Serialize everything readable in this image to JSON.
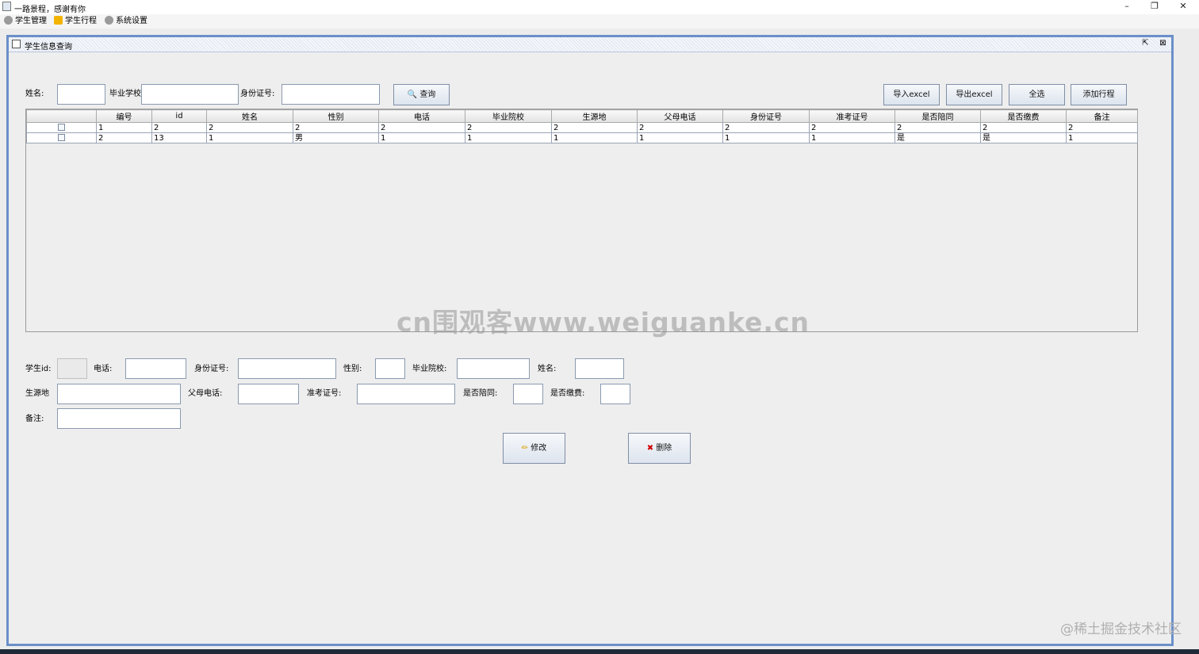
{
  "window": {
    "title": "一路景程，感谢有你",
    "minimize": "–",
    "restore": "❐",
    "close": "✕"
  },
  "menu": [
    {
      "label": "学生管理",
      "icon": "gear-icon",
      "color": "#9a9a9a"
    },
    {
      "label": "学生行程",
      "icon": "star-icon",
      "color": "#f2b400"
    },
    {
      "label": "系统设置",
      "icon": "gear-icon",
      "color": "#9a9a9a"
    }
  ],
  "frame": {
    "title": "学生信息查询",
    "float_icon": "⇱",
    "close_icon": "⊠"
  },
  "search": {
    "name_label": "姓名:",
    "name_value": "",
    "school_label": "毕业学校",
    "school_value": "",
    "idcard_label": "身份证号:",
    "idcard_value": "",
    "query_button": "查询"
  },
  "actions": {
    "import": "导入excel",
    "export": "导出excel",
    "select_all": "全选",
    "add_trip": "添加行程"
  },
  "table": {
    "columns": [
      "",
      "编号",
      "id",
      "姓名",
      "性别",
      "电话",
      "毕业院校",
      "生源地",
      "父母电话",
      "身份证号",
      "准考证号",
      "是否陪同",
      "是否缴费",
      "备注"
    ],
    "rows": [
      [
        "",
        "1",
        "2",
        "2",
        "2",
        "2",
        "2",
        "2",
        "2",
        "2",
        "2",
        "2",
        "2",
        "2"
      ],
      [
        "",
        "2",
        "13",
        "1",
        "男",
        "1",
        "1",
        "1",
        "1",
        "1",
        "1",
        "是",
        "是",
        "1"
      ]
    ]
  },
  "form": {
    "student_id_label": "学生id:",
    "student_id": "",
    "phone_label": "电话:",
    "phone": "",
    "idcard_label": "身份证号:",
    "idcard": "",
    "gender_label": "性别:",
    "gender": "",
    "school_label": "毕业院校:",
    "school": "",
    "name_label": "姓名:",
    "name": "",
    "origin_label": "生源地",
    "origin": "",
    "parent_phone_label": "父母电话:",
    "parent_phone": "",
    "exam_no_label": "准考证号:",
    "exam_no": "",
    "accompany_label": "是否陪同:",
    "accompany": "",
    "paid_label": "是否缴费:",
    "paid": "",
    "remark_label": "备注:",
    "remark": "",
    "edit_button": "修改",
    "delete_button": "删除"
  },
  "watermark": "cn围观客www.weiguanke.cn",
  "credit": "@稀土掘金技术社区"
}
